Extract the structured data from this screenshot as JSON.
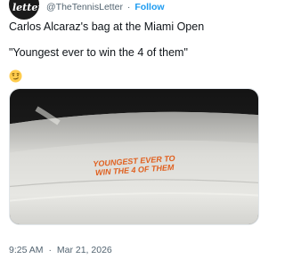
{
  "author": {
    "avatar_text": "letter",
    "handle": "@TheTennisLetter",
    "separator": "·",
    "follow_label": "Follow"
  },
  "tweet": {
    "line1": "Carlos Alcaraz's bag at the Miami Open",
    "line2": "\"Youngest ever to win the 4 of them\"",
    "emoji_icon": "smirk-emoji-icon"
  },
  "media": {
    "bag_text_line1": "YOUNGEST EVER TO",
    "bag_text_line2": "WIN THE 4 OF THEM",
    "text_color": "#e0601f"
  },
  "footer": {
    "time": "9:25 AM",
    "separator": "·",
    "date": "Mar 21, 2026"
  },
  "colors": {
    "text": "#0f1419",
    "secondary": "#536471",
    "link": "#1d9bf0"
  }
}
